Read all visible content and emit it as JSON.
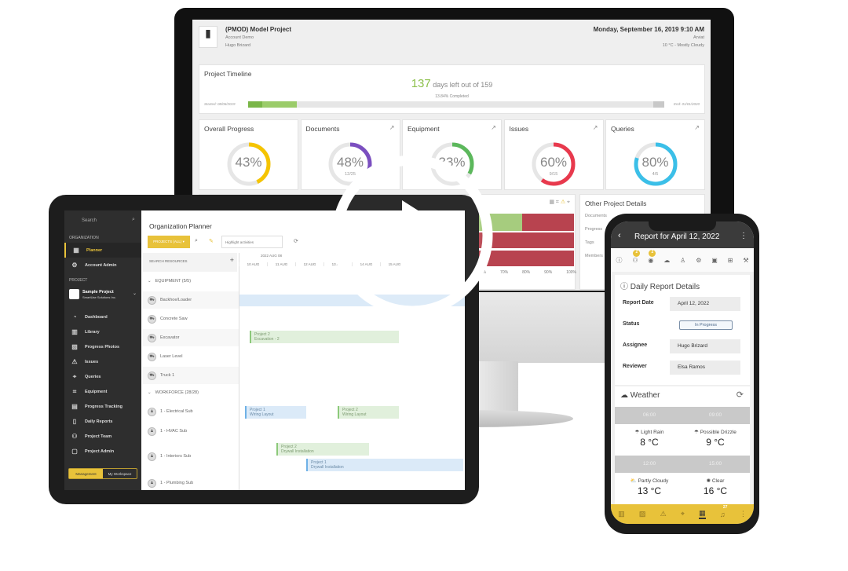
{
  "desktop": {
    "project_title": "(PMOD) Model Project",
    "account": "Account Demo",
    "user": "Hugo Brizard",
    "datetime": "Monday, September 16, 2019 9:10 AM",
    "location": "Arviat",
    "weather": "10 °C - Mostly Cloudy",
    "timeline": {
      "title": "Project Timeline",
      "days_left": "137",
      "days_text": "days left out of 159",
      "completed": "13.84% Completed",
      "started": "Started: 08/06/2019",
      "end": "End: 01/01/2020",
      "progress_percent": 13.84
    },
    "cards": [
      {
        "title": "Overall Progress",
        "value": "43%",
        "sub": "",
        "percent": 43,
        "color": "#f5c400"
      },
      {
        "title": "Documents",
        "value": "48%",
        "sub": "12/25",
        "percent": 48,
        "color": "#7b4fc0"
      },
      {
        "title": "Equipment",
        "value": "33%",
        "sub": "",
        "percent": 33,
        "color": "#5cb85c"
      },
      {
        "title": "Issues",
        "value": "60%",
        "sub": "9/15",
        "percent": 60,
        "color": "#e8394d"
      },
      {
        "title": "Queries",
        "value": "80%",
        "sub": "4/5",
        "percent": 80,
        "color": "#3bbfe8"
      }
    ],
    "chart_ticks": [
      "60%",
      "70%",
      "80%",
      "90%",
      "100%"
    ],
    "other": {
      "title": "Other Project Details",
      "items": [
        "Documents",
        "Progress",
        "Tags",
        "Members"
      ]
    }
  },
  "tablet": {
    "search": "Search",
    "org_header": "ORGANIZATION",
    "project_header": "PROJECT",
    "org_items": [
      {
        "label": "Planner",
        "icon": "calendar-icon"
      },
      {
        "label": "Account Admin",
        "icon": "gears-icon"
      }
    ],
    "project_name": "Sample Project",
    "project_company": "SmartUse Solutions Inc.",
    "nav": [
      {
        "label": "Dashboard",
        "icon": "gauge-icon"
      },
      {
        "label": "Library",
        "icon": "books-icon"
      },
      {
        "label": "Progress Photos",
        "icon": "photo-icon"
      },
      {
        "label": "Issues",
        "icon": "warning-icon"
      },
      {
        "label": "Queries",
        "icon": "pin-icon"
      },
      {
        "label": "Equipment",
        "icon": "scan-icon"
      },
      {
        "label": "Progress Tracking",
        "icon": "tracking-icon"
      },
      {
        "label": "Daily Reports",
        "icon": "report-icon"
      },
      {
        "label": "Project Team",
        "icon": "team-icon"
      },
      {
        "label": "Project Admin",
        "icon": "lock-icon"
      }
    ],
    "mode_buttons": [
      "Management",
      "My Workspace"
    ],
    "planner_title": "Organization Planner",
    "projects_btn": "PROJECTS (ALL) ▾",
    "highlight_placeholder": "Highlight activities",
    "search_resources": "SEARCH RESOURCES",
    "week": "2022 AUG 08",
    "days": [
      "10 AUG",
      "11 AUG",
      "12 AUG",
      "13 AUG",
      "14 AUG",
      "15 AUG"
    ],
    "equipment_header": "EQUIPMENT (5/5)",
    "equipment": [
      "Backhoe/Loader",
      "Concrete Saw",
      "Excavator",
      "Laser Level",
      "Truck 1"
    ],
    "workforce_header": "WORKFORCE (28/28)",
    "workforce": [
      "1 - Electrical Sub",
      "1 - HVAC Sub",
      "1 - Interiors Sub",
      "1 - Plumbing Sub"
    ],
    "bars": [
      {
        "project": "Project 2",
        "task": "Excavation - 2"
      },
      {
        "project": "Project 1",
        "task": "Wiring Layout"
      },
      {
        "project": "Project 2",
        "task": "Wiring Layout"
      },
      {
        "project": "Project 2",
        "task": "Drywall Installation"
      },
      {
        "project": "Project 1",
        "task": "Drywall Installation"
      }
    ]
  },
  "phone": {
    "title": "Report for April 12, 2022",
    "badges": [
      "2",
      "2"
    ],
    "details_title": "Daily Report Details",
    "fields": [
      {
        "label": "Report Date",
        "value": "April 12, 2022"
      },
      {
        "label": "Status",
        "value": "In Progress"
      },
      {
        "label": "Assignee",
        "value": "Hugo Brizard"
      },
      {
        "label": "Reviewer",
        "value": "Elsa Ramos"
      }
    ],
    "weather_title": "Weather",
    "forecast": [
      {
        "time": "06:00",
        "cond": "Light Rain",
        "temp": "8 °C"
      },
      {
        "time": "09:00",
        "cond": "Possible Drizzle",
        "temp": "9 °C"
      },
      {
        "time": "12:00",
        "cond": "Partly Cloudy",
        "temp": "13 °C"
      },
      {
        "time": "15:00",
        "cond": "Clear",
        "temp": "16 °C"
      }
    ],
    "notif_count": "27"
  },
  "colors": {
    "accent": "#e8c23a",
    "green": "#8cc04b",
    "red": "#b8434f"
  }
}
